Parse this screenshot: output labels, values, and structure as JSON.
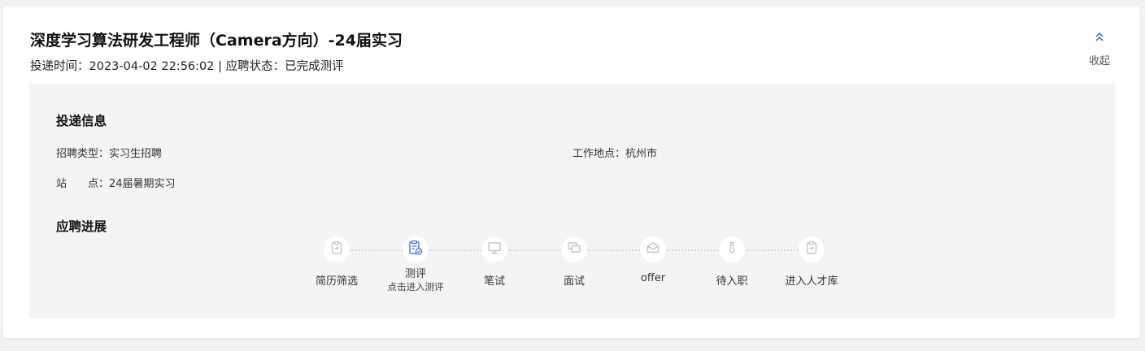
{
  "job": {
    "title": "深度学习算法研发工程师（Camera方向）-24届实习",
    "meta": "投递时间：2023-04-02 22:56:02 | 应聘状态：已完成测评"
  },
  "collapse": {
    "label": "收起",
    "icon": "double-chevron-up-icon"
  },
  "delivery_info": {
    "title": "投递信息",
    "recruit_type": "招聘类型：实习生招聘",
    "location": "工作地点：杭州市",
    "station": "站　　点：24届暑期实习"
  },
  "progress": {
    "title": "应聘进展",
    "steps": [
      {
        "label": "简历筛选",
        "icon": "resume-icon",
        "active": false
      },
      {
        "label": "测评",
        "sub": "点击进入测评",
        "icon": "assessment-icon",
        "active": true
      },
      {
        "label": "笔试",
        "icon": "monitor-icon",
        "active": false
      },
      {
        "label": "面试",
        "icon": "chat-icon",
        "active": false
      },
      {
        "label": "offer",
        "icon": "envelope-icon",
        "active": false
      },
      {
        "label": "待入职",
        "icon": "tie-icon",
        "active": false
      },
      {
        "label": "进入人才库",
        "icon": "resume-icon",
        "active": false
      }
    ]
  },
  "colors": {
    "accent": "#4d6fe8",
    "inactive_icon": "#c4c4c4"
  }
}
